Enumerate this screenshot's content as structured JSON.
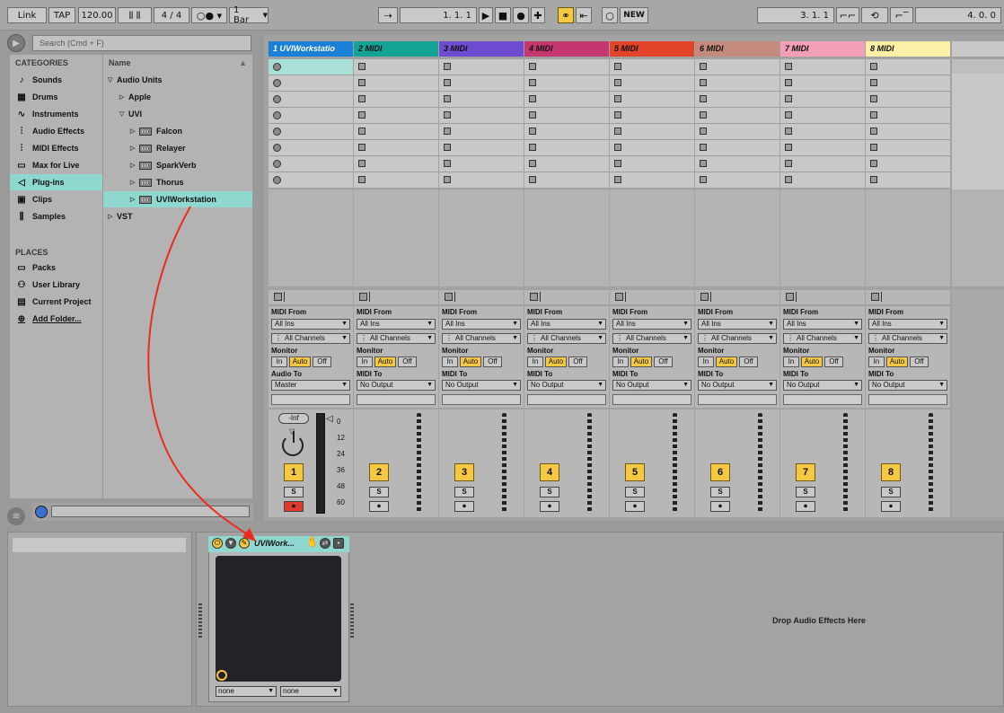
{
  "transport": {
    "link": "Link",
    "tap": "TAP",
    "tempo": "120.00",
    "time_sig": "4 / 4",
    "quantize": "1 Bar",
    "position": "1.  1.  1",
    "new_label": "NEW",
    "loop_start": "3.  1.  1",
    "loop_length": "4.  0.  0"
  },
  "browser": {
    "search_placeholder": "Search (Cmd + F)",
    "categories_title": "CATEGORIES",
    "categories": [
      {
        "label": "Sounds",
        "icon": "note-icon"
      },
      {
        "label": "Drums",
        "icon": "drum-grid-icon"
      },
      {
        "label": "Instruments",
        "icon": "wave-icon"
      },
      {
        "label": "Audio Effects",
        "icon": "audio-fx-icon"
      },
      {
        "label": "MIDI Effects",
        "icon": "midi-fx-icon"
      },
      {
        "label": "Max for Live",
        "icon": "max-icon"
      },
      {
        "label": "Plug-ins",
        "icon": "plug-icon"
      },
      {
        "label": "Clips",
        "icon": "clip-icon"
      },
      {
        "label": "Samples",
        "icon": "sample-icon"
      }
    ],
    "places_title": "PLACES",
    "places": [
      {
        "label": "Packs"
      },
      {
        "label": "User Library"
      },
      {
        "label": "Current Project"
      },
      {
        "label": "Add Folder..."
      }
    ],
    "name_header": "Name",
    "tree": [
      {
        "label": "Audio Units",
        "level": 0
      },
      {
        "label": "Apple",
        "level": 1
      },
      {
        "label": "UVI",
        "level": 1
      },
      {
        "label": "Falcon",
        "level": 2
      },
      {
        "label": "Relayer",
        "level": 2
      },
      {
        "label": "SparkVerb",
        "level": 2
      },
      {
        "label": "Thorus",
        "level": 2
      },
      {
        "label": "UVIWorkstation",
        "level": 2
      },
      {
        "label": "VST",
        "level": 0
      }
    ]
  },
  "tracks": [
    {
      "name": "1 UVIWorkstatio",
      "color": "#1a7fd6",
      "num": "1",
      "armed": true
    },
    {
      "name": "2 MIDI",
      "color": "#13a394",
      "num": "2",
      "armed": false
    },
    {
      "name": "3 MIDI",
      "color": "#6e4bd0",
      "num": "3",
      "armed": false
    },
    {
      "name": "4 MIDI",
      "color": "#c4386f",
      "num": "4",
      "armed": false
    },
    {
      "name": "5 MIDI",
      "color": "#e2442a",
      "num": "5",
      "armed": false
    },
    {
      "name": "6 MIDI",
      "color": "#c48a7c",
      "num": "6",
      "armed": false
    },
    {
      "name": "7 MIDI",
      "color": "#f3a0b6",
      "num": "7",
      "armed": false
    },
    {
      "name": "8 MIDI",
      "color": "#fbf0a6",
      "num": "8",
      "armed": false
    }
  ],
  "io": {
    "midi_from": "MIDI From",
    "all_ins": "All Ins",
    "all_channels": "All Channels",
    "monitor": "Monitor",
    "in": "In",
    "auto": "Auto",
    "off": "Off",
    "audio_to": "Audio To",
    "master": "Master",
    "midi_to": "MIDI To",
    "no_output": "No Output"
  },
  "mixer": {
    "volume": "-Inf",
    "solo": "S",
    "scale": [
      "0",
      "12",
      "24",
      "36",
      "48",
      "60"
    ]
  },
  "device": {
    "title": "UVIWork...",
    "macro1": "none",
    "macro2": "none",
    "drop_text": "Drop Audio Effects Here"
  }
}
